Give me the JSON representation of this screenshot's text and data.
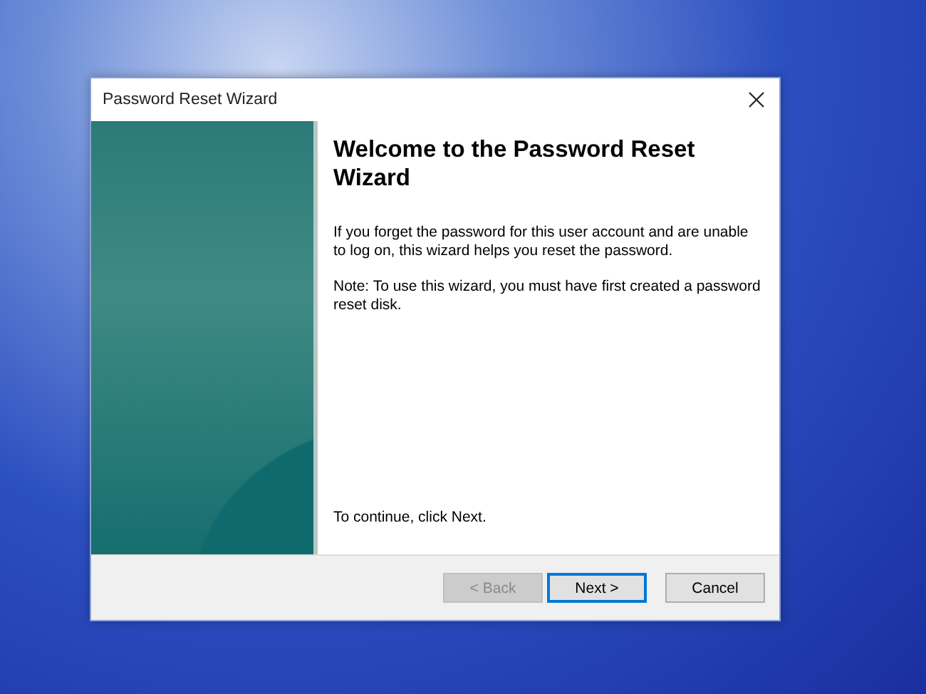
{
  "window": {
    "title": "Password Reset Wizard"
  },
  "heading": "Welcome to the Password Reset Wizard",
  "paragraphs": [
    "If you forget the password for this user account and are unable to log on, this wizard helps you reset the password.",
    "Note: To use this wizard, you must have first created a password reset disk."
  ],
  "footer_text": "To continue, click Next.",
  "buttons": [
    {
      "label": "< Back",
      "disabled": true,
      "default": false
    },
    {
      "label": "Next >",
      "disabled": false,
      "default": true
    },
    {
      "label": "Cancel",
      "disabled": false,
      "default": false
    }
  ]
}
